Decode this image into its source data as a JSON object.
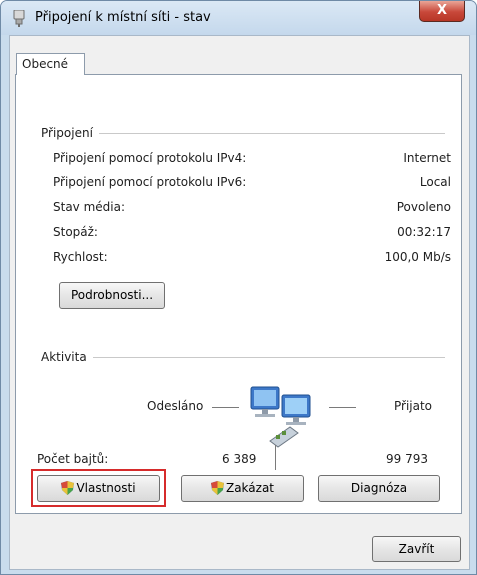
{
  "window": {
    "title": "Připojení k místní síti - stav",
    "close_label": "X"
  },
  "tabs": [
    {
      "label": "Obecné"
    }
  ],
  "connection": {
    "group_label": "Připojení",
    "rows": [
      {
        "label": "Připojení pomocí protokolu IPv4:",
        "value": "Internet"
      },
      {
        "label": "Připojení pomocí protokolu IPv6:",
        "value": "Local"
      },
      {
        "label": "Stav média:",
        "value": "Povoleno"
      },
      {
        "label": "Stopáž:",
        "value": "00:32:17"
      },
      {
        "label": "Rychlost:",
        "value": "100,0 Mb/s"
      }
    ],
    "details_button": "Podrobnosti..."
  },
  "activity": {
    "group_label": "Aktivita",
    "sent_label": "Odesláno",
    "received_label": "Přijato",
    "bytes_label": "Počet bajtů:",
    "bytes_sent": "6 389",
    "bytes_received": "99 793",
    "network_icon": "network-computers-icon"
  },
  "buttons": {
    "properties": "Vlastnosti",
    "disable": "Zakázat",
    "diagnose": "Diagnóza",
    "close": "Zavřít"
  },
  "colors": {
    "highlight": "#d62b2b",
    "close_button": "#c8483a"
  }
}
